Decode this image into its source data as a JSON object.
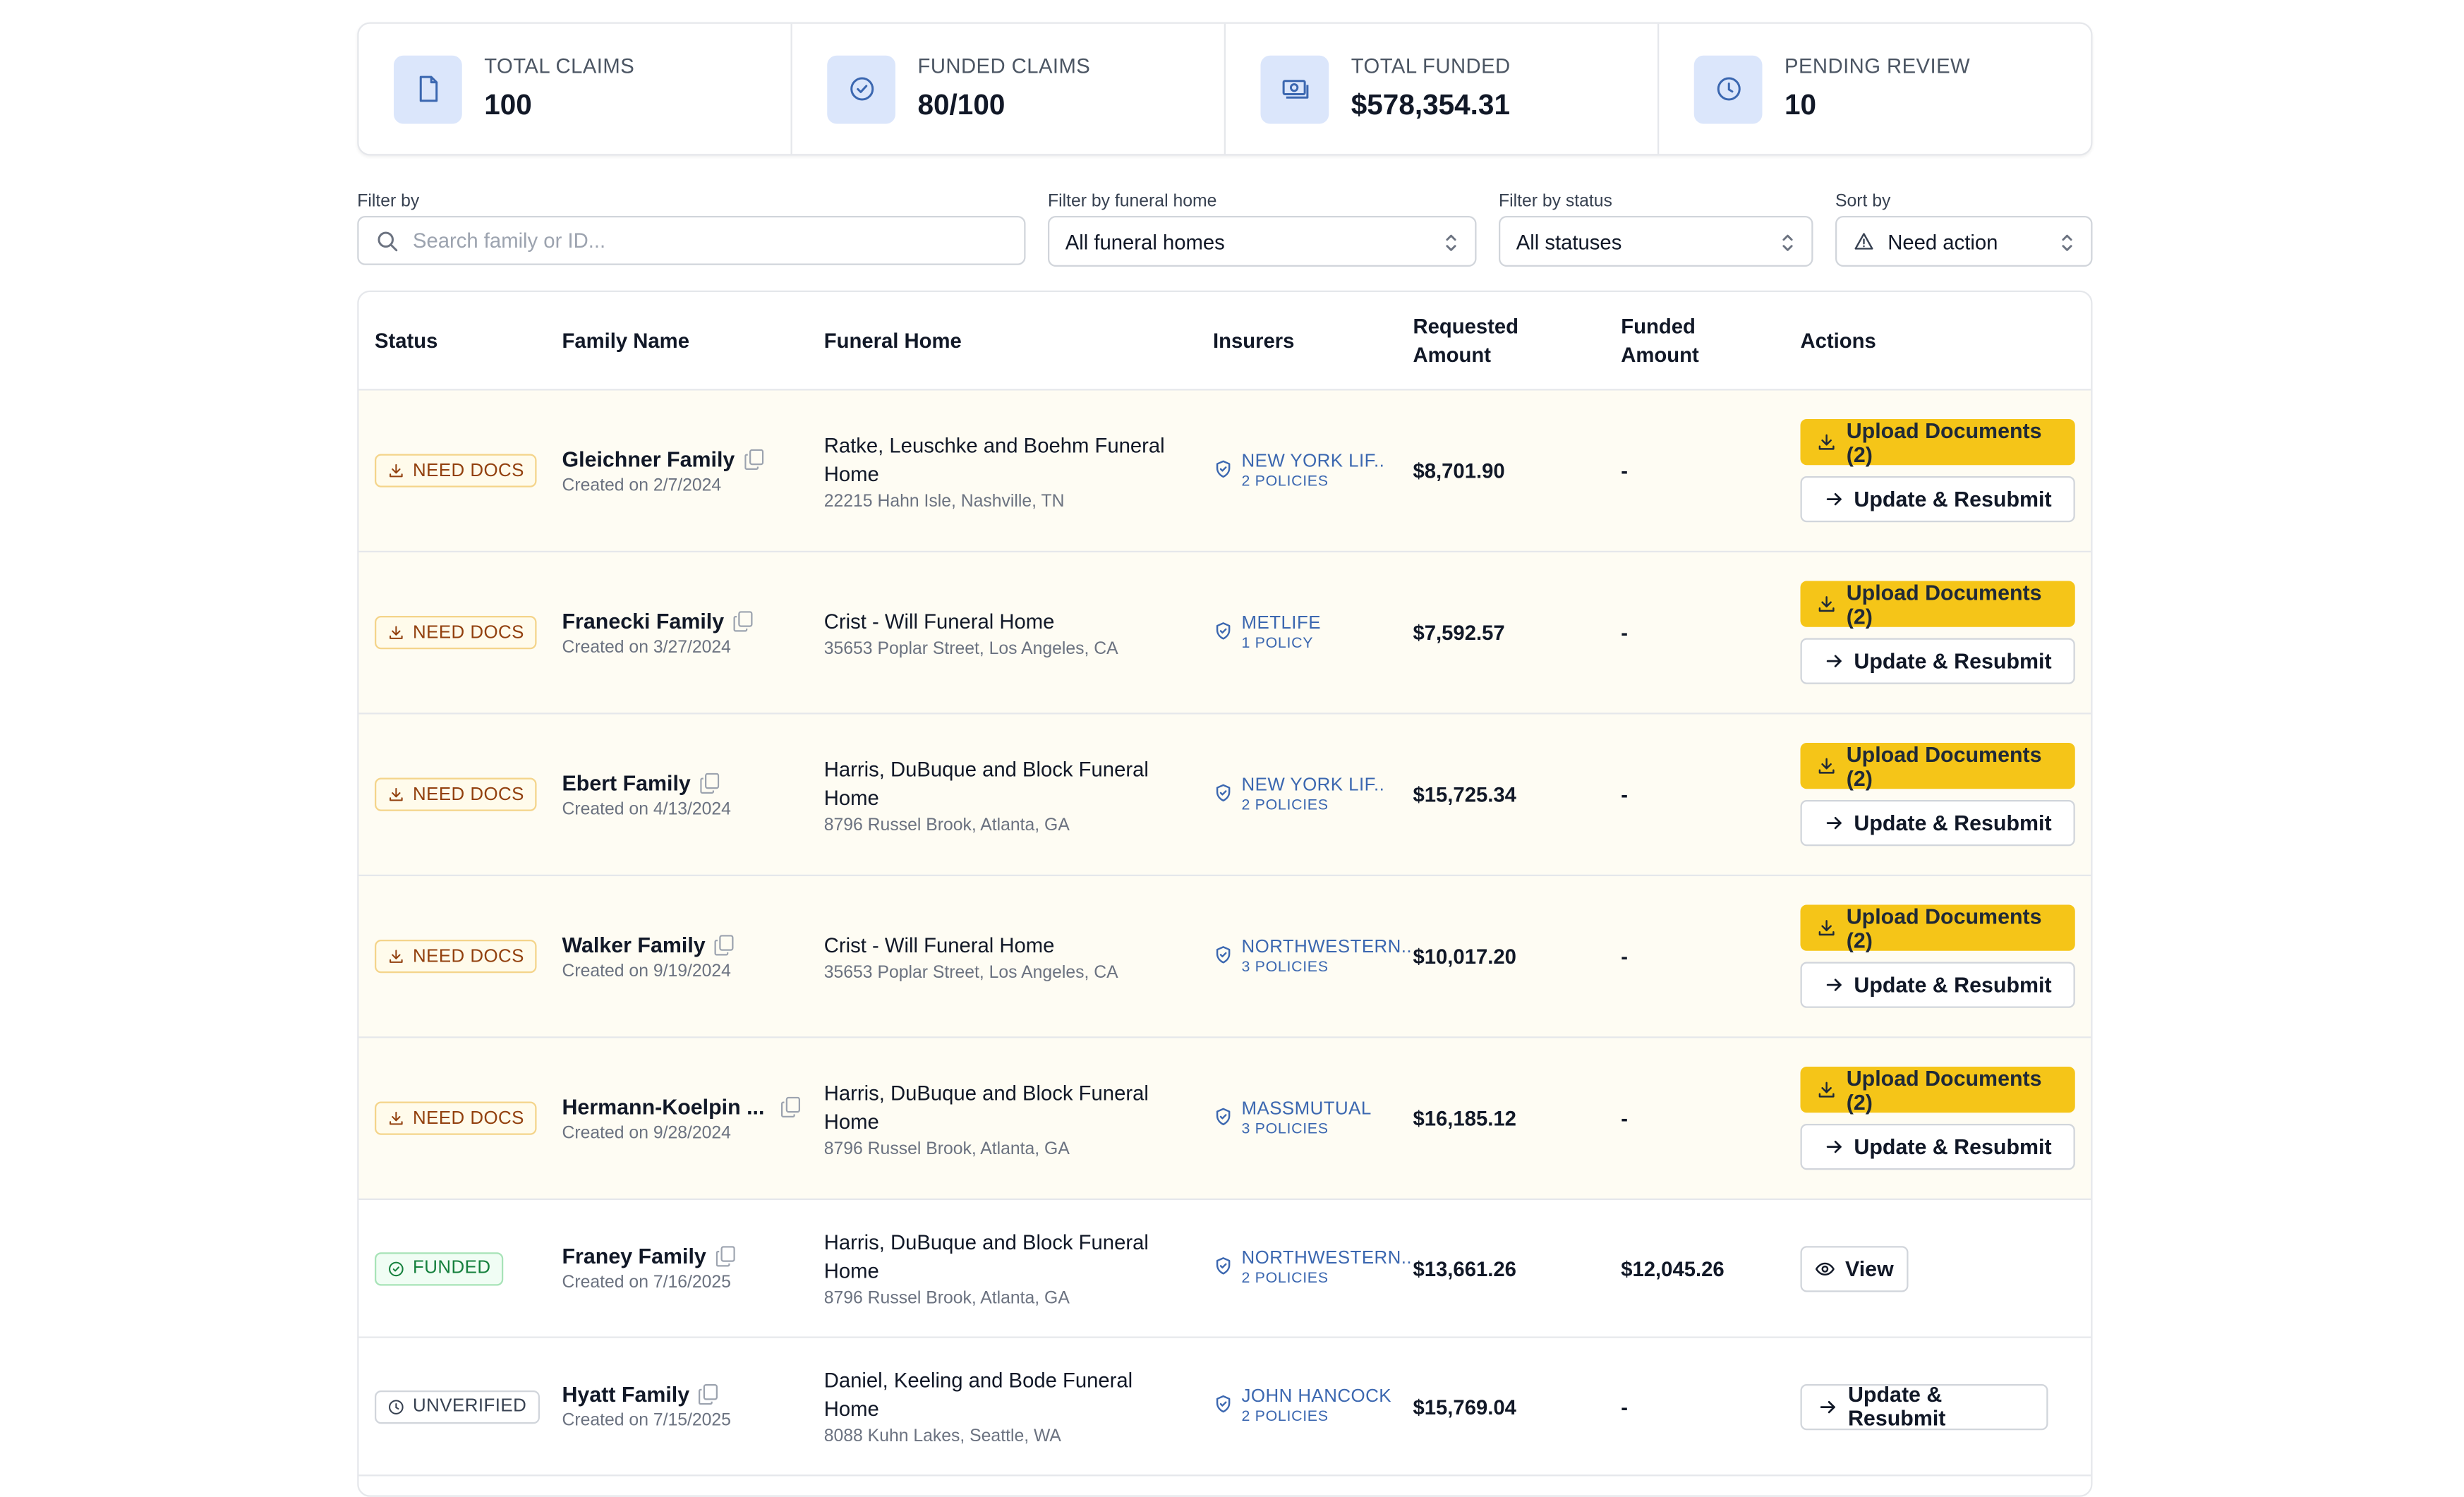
{
  "stats": [
    {
      "label": "TOTAL CLAIMS",
      "value": "100",
      "icon": "document-icon"
    },
    {
      "label": "FUNDED CLAIMS",
      "value": "80/100",
      "icon": "check-circle-icon"
    },
    {
      "label": "TOTAL FUNDED",
      "value": "$578,354.31",
      "icon": "cash-icon"
    },
    {
      "label": "PENDING REVIEW",
      "value": "10",
      "icon": "clock-icon"
    }
  ],
  "filters": {
    "filter_by": {
      "label": "Filter by",
      "placeholder": "Search family or ID..."
    },
    "funeral_home": {
      "label": "Filter by funeral home",
      "value": "All funeral homes"
    },
    "status": {
      "label": "Filter by status",
      "value": "All statuses"
    },
    "sort": {
      "label": "Sort by",
      "value": "Need action"
    }
  },
  "table": {
    "headers": {
      "status": "Status",
      "family": "Family Name",
      "home": "Funeral Home",
      "insurers": "Insurers",
      "requested": "Requested Amount",
      "funded": "Funded Amount",
      "actions": "Actions"
    },
    "rows": [
      {
        "status": "NEED DOCS",
        "family": "Gleichner Family",
        "created": "Created on 2/7/2024",
        "home": "Ratke, Leuschke and Boehm Funeral Home",
        "address": "22215 Hahn Isle, Nashville, TN",
        "insurer": "NEW YORK LIF..",
        "policies": "2 POLICIES",
        "requested": "$8,701.90",
        "funded": "-",
        "upload": "Upload Documents (2)",
        "resubmit": "Update & Resubmit"
      },
      {
        "status": "NEED DOCS",
        "family": "Franecki Family",
        "created": "Created on 3/27/2024",
        "home": "Crist - Will Funeral Home",
        "address": "35653 Poplar Street, Los Angeles, CA",
        "insurer": "METLIFE",
        "policies": "1 POLICY",
        "requested": "$7,592.57",
        "funded": "-",
        "upload": "Upload Documents (2)",
        "resubmit": "Update & Resubmit"
      },
      {
        "status": "NEED DOCS",
        "family": "Ebert Family",
        "created": "Created on 4/13/2024",
        "home": "Harris, DuBuque and Block Funeral Home",
        "address": "8796 Russel Brook, Atlanta, GA",
        "insurer": "NEW YORK LIF..",
        "policies": "2 POLICIES",
        "requested": "$15,725.34",
        "funded": "-",
        "upload": "Upload Documents (2)",
        "resubmit": "Update & Resubmit"
      },
      {
        "status": "NEED DOCS",
        "family": "Walker Family",
        "created": "Created on 9/19/2024",
        "home": "Crist - Will Funeral Home",
        "address": "35653 Poplar Street, Los Angeles, CA",
        "insurer": "NORTHWESTERN..",
        "policies": "3 POLICIES",
        "requested": "$10,017.20",
        "funded": "-",
        "upload": "Upload Documents (2)",
        "resubmit": "Update & Resubmit"
      },
      {
        "status": "NEED DOCS",
        "family": "Hermann-Koelpin ...",
        "created": "Created on 9/28/2024",
        "home": "Harris, DuBuque and Block Funeral Home",
        "address": "8796 Russel Brook, Atlanta, GA",
        "insurer": "MASSMUTUAL",
        "policies": "3 POLICIES",
        "requested": "$16,185.12",
        "funded": "-",
        "upload": "Upload Documents (2)",
        "resubmit": "Update & Resubmit"
      },
      {
        "status": "FUNDED",
        "family": "Franey Family",
        "created": "Created on 7/16/2025",
        "home": "Harris, DuBuque and Block Funeral Home",
        "address": "8796 Russel Brook, Atlanta, GA",
        "insurer": "NORTHWESTERN..",
        "policies": "2 POLICIES",
        "requested": "$13,661.26",
        "funded": "$12,045.26",
        "view": "View"
      },
      {
        "status": "UNVERIFIED",
        "family": "Hyatt Family",
        "created": "Created on 7/15/2025",
        "home": "Daniel, Keeling and Bode Funeral Home",
        "address": "8088 Kuhn Lakes, Seattle, WA",
        "insurer": "JOHN HANCOCK",
        "policies": "2 POLICIES",
        "requested": "$15,769.04",
        "funded": "-",
        "resubmit": "Update & Resubmit"
      }
    ]
  },
  "colors": {
    "accent": "#f5c518",
    "link": "#3b67b0",
    "icon_bg": "#dbe6fb",
    "need_bg": "#fefcf3"
  }
}
